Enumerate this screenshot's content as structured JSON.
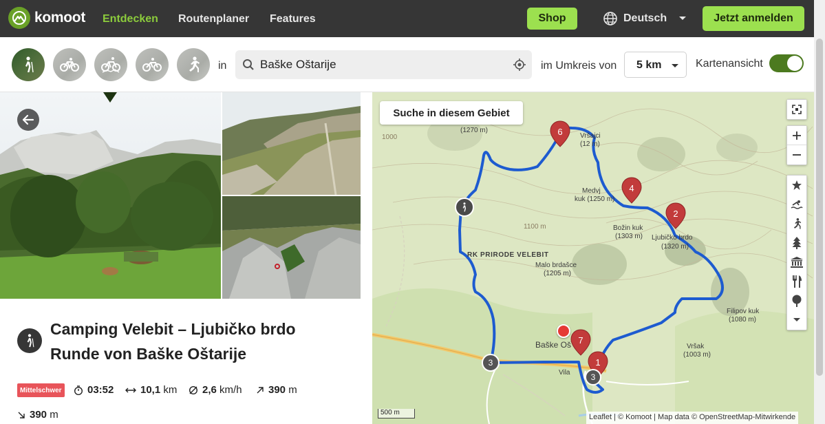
{
  "brand": {
    "name": "komoot",
    "accent": "#6aa127"
  },
  "nav": {
    "links": [
      "Entdecken",
      "Routenplaner",
      "Features"
    ],
    "shop": "Shop",
    "language": "Deutsch",
    "login": "Jetzt anmelden"
  },
  "filters": {
    "sports": [
      {
        "icon": "hiking-icon",
        "active": true
      },
      {
        "icon": "bike-icon",
        "active": false
      },
      {
        "icon": "mountain-bike-icon",
        "active": false
      },
      {
        "icon": "road-bike-icon",
        "active": false
      },
      {
        "icon": "running-icon",
        "active": false
      }
    ],
    "in_label": "in",
    "search_value": "Baške Oštarije",
    "radius_label": "im Umkreis von",
    "radius_value": "5 km",
    "map_view_label": "Kartenansicht",
    "map_view_on": true
  },
  "tour": {
    "title_line1": "Camping Velebit – Ljubičko brdo",
    "title_line2": "Runde von Baške Oštarije",
    "difficulty": "Mittelschwer",
    "duration": "03:52",
    "distance_value": "10,1",
    "distance_unit": "km",
    "speed_value": "2,6",
    "speed_unit": "km/h",
    "ascent_value": "390",
    "ascent_unit": "m",
    "descent_value": "390",
    "descent_unit": "m"
  },
  "map": {
    "search_area": "Suche in diesem Gebiet",
    "scale": "500 m",
    "attribution": "Leaflet | © Komoot | Map data © OpenStreetMap-Mitwirkende",
    "labels": {
      "l1270": "(1270 m)",
      "vrsajci": "Vršajci",
      "vrsajci_h": "(12 m)",
      "medvjak": "Medvj",
      "medvjak2": "kuk (1250 m)",
      "bozin": "Božin kuk",
      "bozin_h": "(1303 m)",
      "ljubicko": "Ljubičko brdo",
      "ljubicko_h": "(1320 m)",
      "park": "RK PRIRODE VELEBIT",
      "malo": "Malo brdašce",
      "malo_h": "(1205 m)",
      "filipov": "Filipov kuk",
      "filipov_h": "(1080 m)",
      "vrsak": "Vršak",
      "vrsak_h": "(1003 m)",
      "baske": "Baške Oš",
      "vila": "Vila",
      "c1100": "1100 m",
      "c1000": "1000"
    },
    "markers": [
      "6",
      "4",
      "2",
      "7",
      "1",
      "3",
      "3"
    ]
  }
}
